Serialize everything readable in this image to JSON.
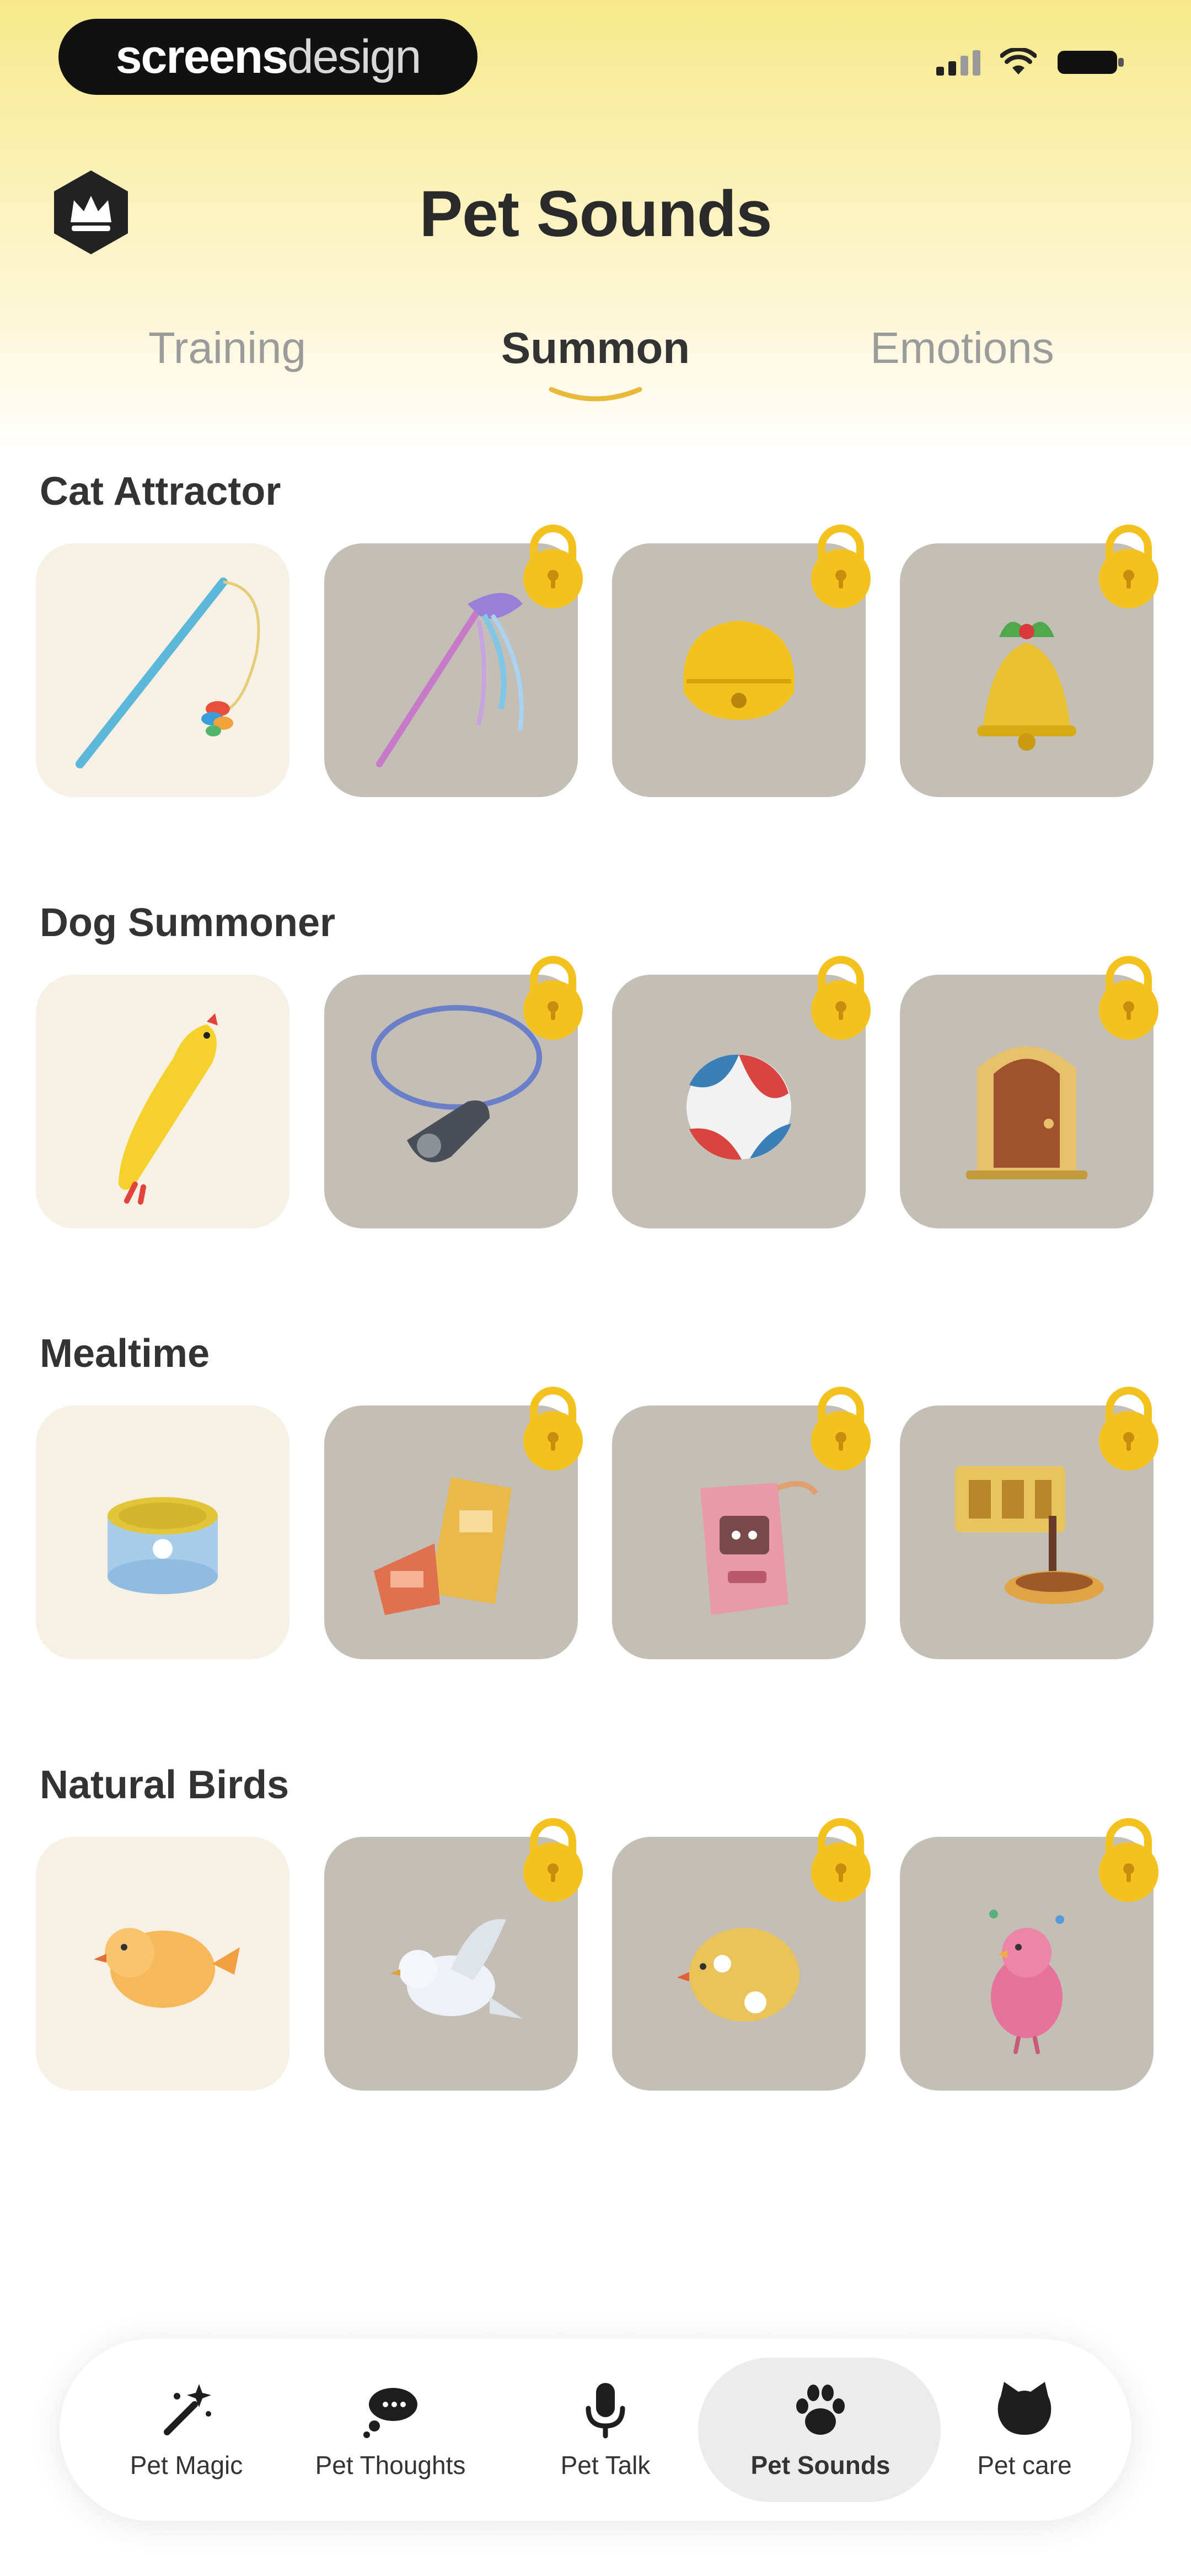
{
  "status_bar": {
    "brand_bold": "screens",
    "brand_light": "design"
  },
  "header": {
    "title": "Pet Sounds"
  },
  "tabs": [
    {
      "label": "Training",
      "active": false
    },
    {
      "label": "Summon",
      "active": true
    },
    {
      "label": "Emotions",
      "active": false
    }
  ],
  "sections": [
    {
      "title": "Cat Attractor",
      "items": [
        {
          "icon": "feather-wand-icon",
          "locked": false
        },
        {
          "icon": "ribbon-wand-icon",
          "locked": true
        },
        {
          "icon": "yellow-bell-icon",
          "locked": true
        },
        {
          "icon": "christmas-bell-icon",
          "locked": true
        }
      ]
    },
    {
      "title": "Dog Summoner",
      "items": [
        {
          "icon": "rubber-chicken-icon",
          "locked": false
        },
        {
          "icon": "whistle-icon",
          "locked": true
        },
        {
          "icon": "beach-ball-icon",
          "locked": true
        },
        {
          "icon": "door-icon",
          "locked": true
        }
      ]
    },
    {
      "title": "Mealtime",
      "items": [
        {
          "icon": "food-can-icon",
          "locked": false
        },
        {
          "icon": "treat-bag-icon",
          "locked": true
        },
        {
          "icon": "kibble-bag-icon",
          "locked": true
        },
        {
          "icon": "food-bowl-sign-icon",
          "locked": true
        }
      ]
    },
    {
      "title": "Natural Birds",
      "items": [
        {
          "icon": "orange-bird-icon",
          "locked": false
        },
        {
          "icon": "dove-icon",
          "locked": true
        },
        {
          "icon": "yellow-chick-icon",
          "locked": true
        },
        {
          "icon": "pink-bird-icon",
          "locked": true
        }
      ]
    }
  ],
  "bottom_nav": [
    {
      "label": "Pet Magic",
      "icon": "magic-wand-icon",
      "active": false
    },
    {
      "label": "Pet Thoughts",
      "icon": "thought-bubble-icon",
      "active": false
    },
    {
      "label": "Pet Talk",
      "icon": "microphone-icon",
      "active": false
    },
    {
      "label": "Pet Sounds",
      "icon": "paw-icon",
      "active": true
    },
    {
      "label": "Pet care",
      "icon": "cat-head-icon",
      "active": false
    }
  ],
  "colors": {
    "accent": "#e9b93a",
    "tile_locked": "#c3beb6",
    "tile_free": "#f6f1e4",
    "lock": "#f3c21f"
  }
}
